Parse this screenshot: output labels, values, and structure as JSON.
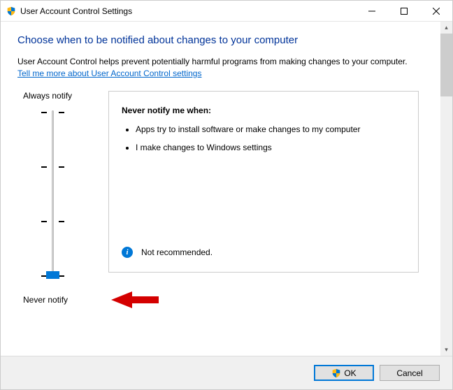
{
  "window": {
    "title": "User Account Control Settings"
  },
  "page": {
    "heading": "Choose when to be notified about changes to your computer",
    "description": "User Account Control helps prevent potentially harmful programs from making changes to your computer.",
    "help_link": "Tell me more about User Account Control settings"
  },
  "slider": {
    "top_label": "Always notify",
    "bottom_label": "Never notify",
    "position": 3,
    "levels": 4
  },
  "info": {
    "title": "Never notify me when:",
    "bullets": [
      "Apps try to install software or make changes to my computer",
      "I make changes to Windows settings"
    ],
    "status": "Not recommended."
  },
  "buttons": {
    "ok": "OK",
    "cancel": "Cancel"
  }
}
